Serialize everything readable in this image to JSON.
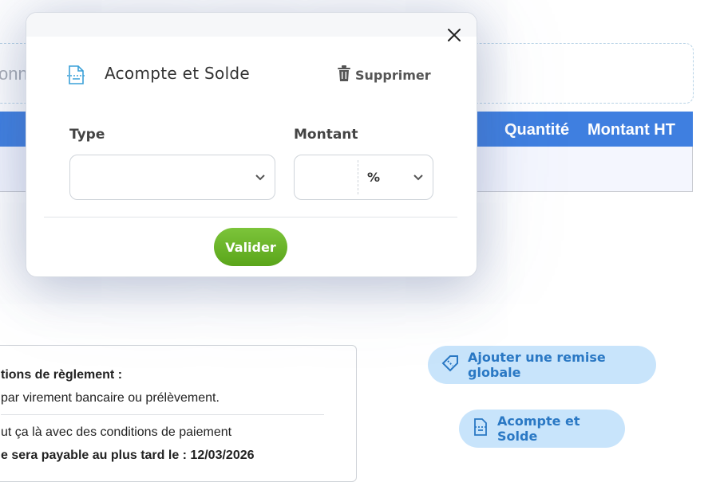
{
  "background": {
    "dashed_box_text": "onn",
    "table_headers": [
      "Quantité",
      "Montant HT"
    ],
    "conditions": {
      "title": "tions de règlement :",
      "line1": "par virement bancaire ou prélèvement.",
      "line2": "ut ça là avec des conditions de paiement",
      "line3": "e sera payable au plus tard le : 12/03/2026"
    },
    "buttons": {
      "remise": "Ajouter une remise globale",
      "acompte": "Acompte et Solde"
    }
  },
  "modal": {
    "title": "Acompte et Solde",
    "delete_label": "Supprimer",
    "type_label": "Type",
    "type_value": "",
    "montant_label": "Montant",
    "montant_value": "",
    "unit_value": "%",
    "submit_label": "Valider"
  },
  "colors": {
    "accent_blue": "#3f7fe0",
    "submit_green": "#6ab52a",
    "pill_bg": "#c8e4fb",
    "pill_text": "#2a78c4"
  }
}
